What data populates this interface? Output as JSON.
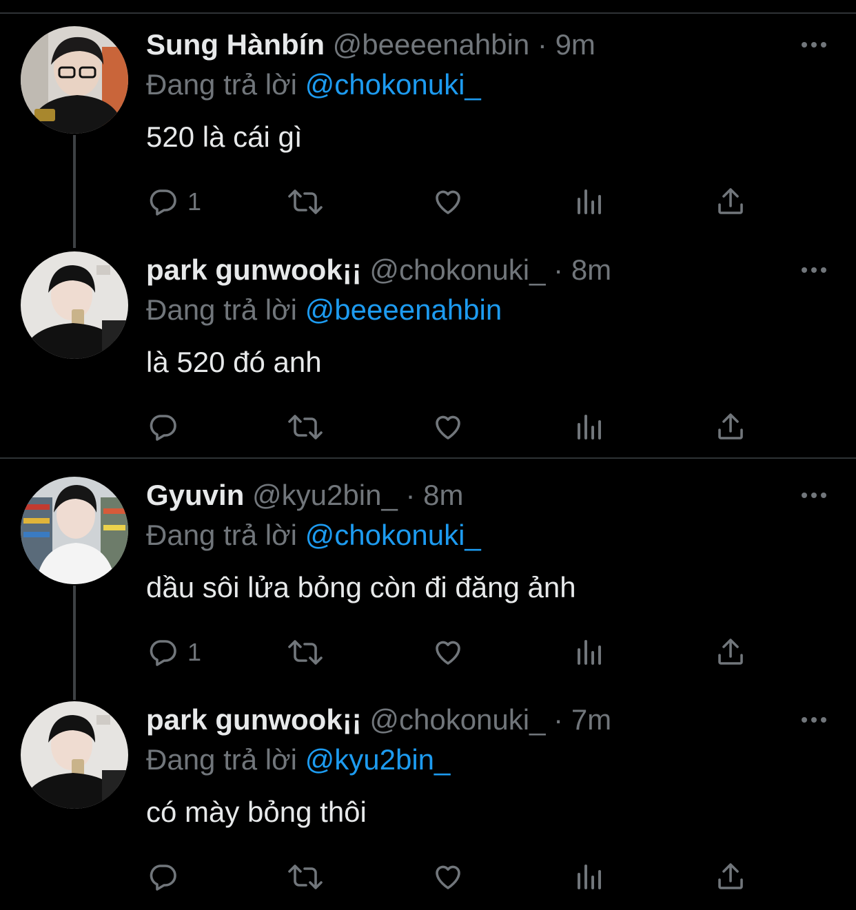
{
  "colors": {
    "background": "#000000",
    "text_primary": "#e7e9ea",
    "text_secondary": "#71767b",
    "link": "#1d9bf0",
    "divider": "#2f3336"
  },
  "icons": {
    "more": "more-horizontal-icon",
    "reply": "reply-bubble-icon",
    "retweet": "retweet-icon",
    "like": "heart-icon",
    "views": "bar-chart-icon",
    "share": "share-upload-icon"
  },
  "tweets": [
    {
      "name": "Sung Hànbín",
      "handle": "@beeeenahbin",
      "dot": "·",
      "time": "9m",
      "reply_prefix": "Đang trả lời",
      "reply_to": "@chokonuki_",
      "text": "520 là cái gì",
      "reply_count": "1"
    },
    {
      "name": "park gunwook¡¡",
      "handle": "@chokonuki_",
      "dot": "·",
      "time": "8m",
      "reply_prefix": "Đang trả lời",
      "reply_to": "@beeeenahbin",
      "text": "là 520 đó anh",
      "reply_count": ""
    },
    {
      "name": "Gyuvin",
      "handle": "@kyu2bin_",
      "dot": "·",
      "time": "8m",
      "reply_prefix": "Đang trả lời",
      "reply_to": "@chokonuki_",
      "text": "dầu sôi lửa bỏng còn đi đăng ảnh",
      "reply_count": "1"
    },
    {
      "name": "park gunwook¡¡",
      "handle": "@chokonuki_",
      "dot": "·",
      "time": "7m",
      "reply_prefix": "Đang trả lời",
      "reply_to": "@kyu2bin_",
      "text": "có mày bỏng thôi",
      "reply_count": ""
    }
  ]
}
